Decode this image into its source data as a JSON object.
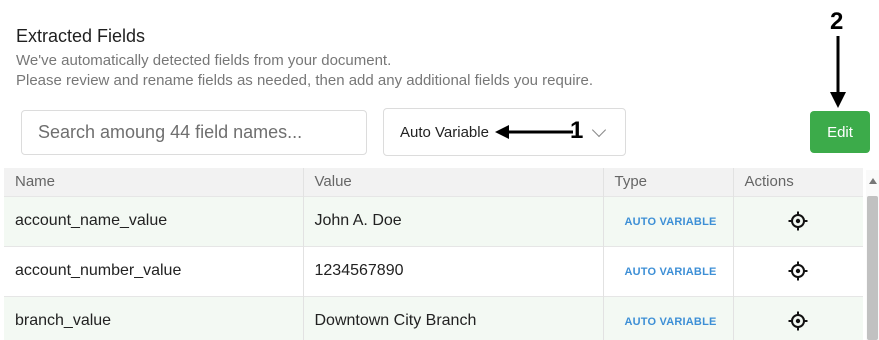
{
  "header": {
    "title": "Extracted Fields",
    "description_line1": "We've automatically detected fields from your document.",
    "description_line2": "Please review and rename fields as needed, then add any additional fields you require."
  },
  "toolbar": {
    "search_placeholder": "Search amoung 44 field names...",
    "filter_value": "Auto Variable",
    "edit_label": "Edit"
  },
  "annotations": {
    "marker1": "1",
    "marker2": "2"
  },
  "table": {
    "columns": [
      "Name",
      "Value",
      "Type",
      "Actions"
    ],
    "rows": [
      {
        "name": "account_name_value",
        "value": "John A. Doe",
        "type": "AUTO VARIABLE",
        "action_icon": "target-icon"
      },
      {
        "name": "account_number_value",
        "value": "1234567890",
        "type": "AUTO VARIABLE",
        "action_icon": "target-icon"
      },
      {
        "name": "branch_value",
        "value": "Downtown City Branch",
        "type": "AUTO VARIABLE",
        "action_icon": "target-icon"
      }
    ]
  },
  "colors": {
    "edit_button": "#3cab4a",
    "type_badge": "#3d8fd6",
    "row_highlight": "#f3f9f3"
  }
}
